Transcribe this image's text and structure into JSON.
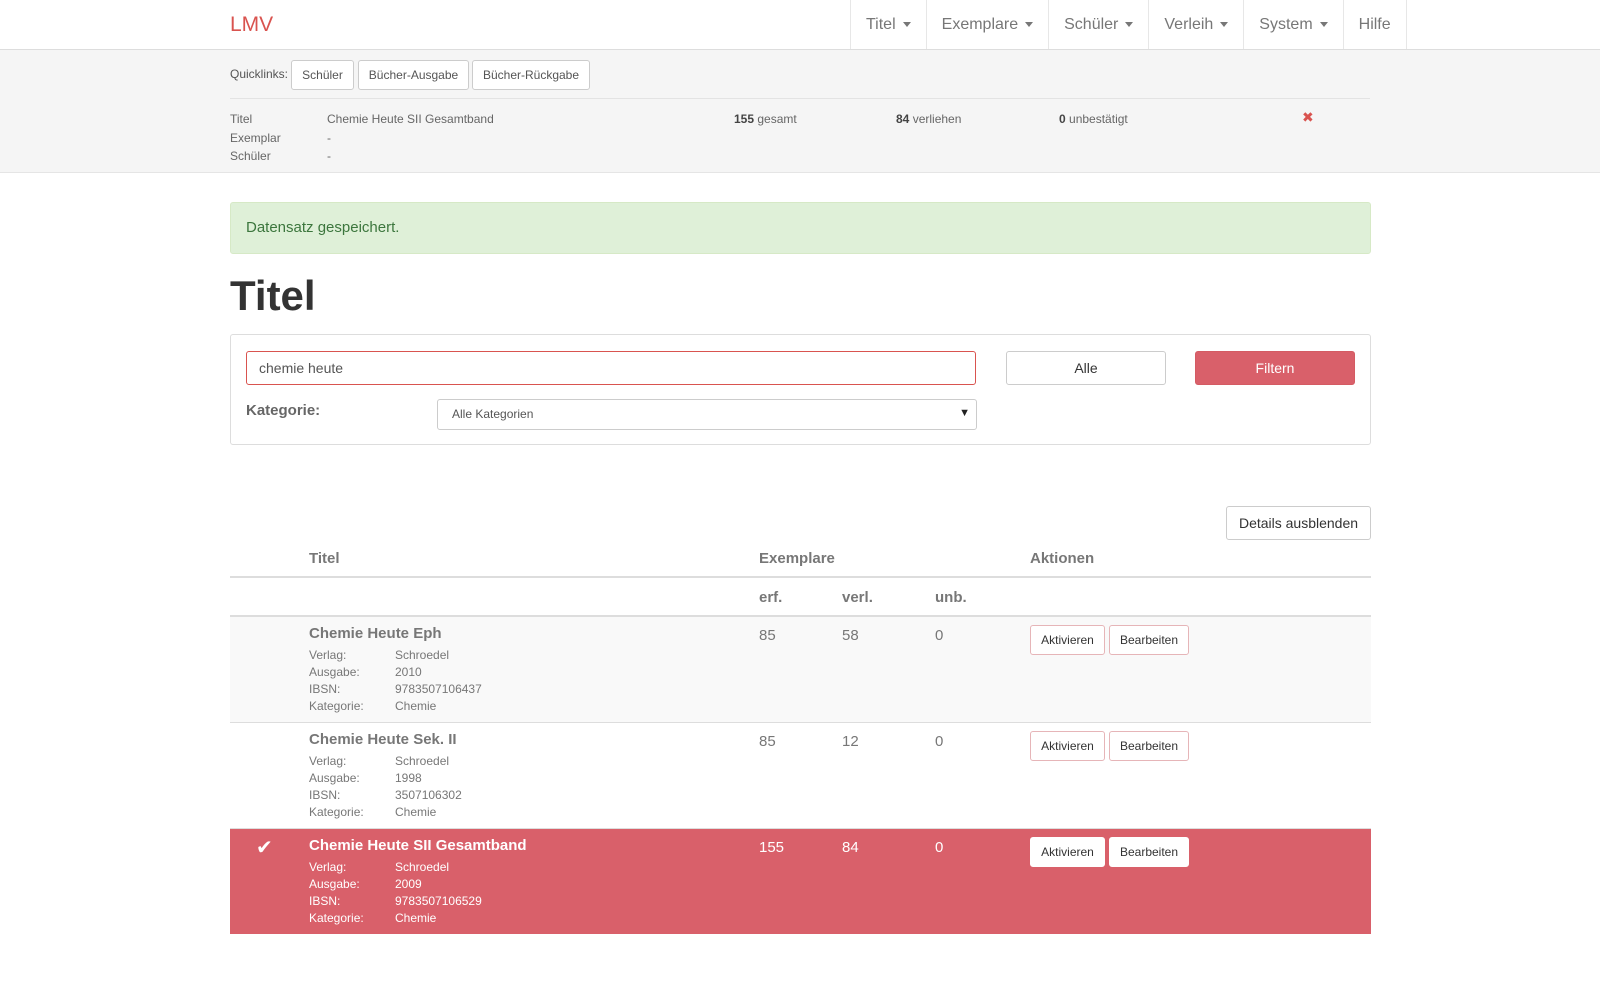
{
  "navbar": {
    "brand": "LMV",
    "items": [
      {
        "label": "Titel",
        "dropdown": true
      },
      {
        "label": "Exemplare",
        "dropdown": true
      },
      {
        "label": "Schüler",
        "dropdown": true
      },
      {
        "label": "Verleih",
        "dropdown": true
      },
      {
        "label": "System",
        "dropdown": true
      },
      {
        "label": "Hilfe",
        "dropdown": false
      }
    ]
  },
  "quicklinks": {
    "label": "Quicklinks:",
    "buttons": [
      "Schüler",
      "Bücher-Ausgabe",
      "Bücher-Rückgabe"
    ]
  },
  "info": {
    "titel_label": "Titel",
    "titel_value": "Chemie Heute SII Gesamtband",
    "exemplar_label": "Exemplar",
    "exemplar_value": "-",
    "schueler_label": "Schüler",
    "schueler_value": "-",
    "gesamt_count": "155",
    "gesamt_label": "gesamt",
    "verliehen_count": "84",
    "verliehen_label": "verliehen",
    "unbestaetigt_count": "0",
    "unbestaetigt_label": "unbestätigt",
    "close_glyph": "✖"
  },
  "alert": {
    "text": "Datensatz gespeichert."
  },
  "page_title": "Titel",
  "filter": {
    "search_value": "chemie heute",
    "alle_label": "Alle",
    "filtern_label": "Filtern",
    "kategorie_label": "Kategorie:",
    "kategorie_selected": "Alle Kategorien"
  },
  "details_button": "Details ausblenden",
  "table": {
    "headers": {
      "titel": "Titel",
      "exemplare": "Exemplare",
      "aktionen": "Aktionen",
      "erf": "erf.",
      "verl": "verl.",
      "unb": "unb."
    },
    "meta_labels": {
      "verlag": "Verlag:",
      "ausgabe": "Ausgabe:",
      "ibsn": "IBSN:",
      "kategorie": "Kategorie:"
    },
    "action_labels": {
      "aktivieren": "Aktivieren",
      "bearbeiten": "Bearbeiten"
    },
    "rows": [
      {
        "title": "Chemie Heute Eph",
        "verlag": "Schroedel",
        "ausgabe": "2010",
        "ibsn": "9783507106437",
        "kategorie": "Chemie",
        "erf": "85",
        "verl": "58",
        "unb": "0",
        "selected": false
      },
      {
        "title": "Chemie Heute Sek. II",
        "verlag": "Schroedel",
        "ausgabe": "1998",
        "ibsn": "3507106302",
        "kategorie": "Chemie",
        "erf": "85",
        "verl": "12",
        "unb": "0",
        "selected": false
      },
      {
        "title": "Chemie Heute SII Gesamtband",
        "verlag": "Schroedel",
        "ausgabe": "2009",
        "ibsn": "9783507106529",
        "kategorie": "Chemie",
        "erf": "155",
        "verl": "84",
        "unb": "0",
        "selected": true
      }
    ]
  },
  "colors": {
    "accent": "#d9534f",
    "active_row": "#d9606a",
    "alert_bg": "#dff0d8",
    "alert_text": "#3c763d"
  }
}
